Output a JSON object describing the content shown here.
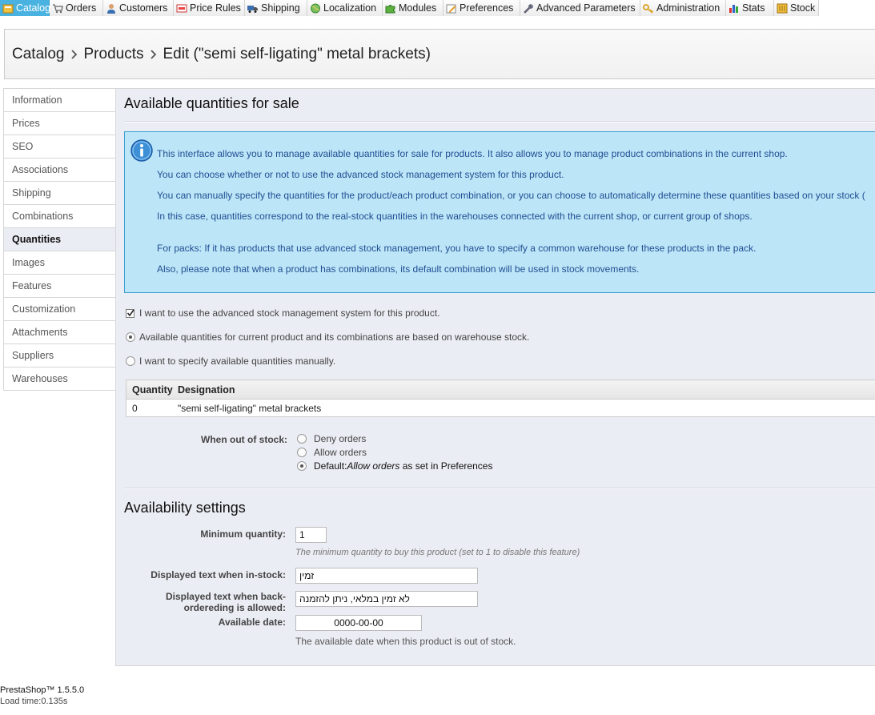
{
  "nav": {
    "tabs": [
      {
        "label": "Catalog",
        "icon": "catalog-icon",
        "active": true
      },
      {
        "label": "Orders",
        "icon": "cart-icon"
      },
      {
        "label": "Customers",
        "icon": "customers-icon"
      },
      {
        "label": "Price Rules",
        "icon": "price-rules-icon"
      },
      {
        "label": "Shipping",
        "icon": "truck-icon"
      },
      {
        "label": "Localization",
        "icon": "globe-icon"
      },
      {
        "label": "Modules",
        "icon": "puzzle-icon"
      },
      {
        "label": "Preferences",
        "icon": "preferences-icon"
      },
      {
        "label": "Advanced Parameters",
        "icon": "wrench-icon"
      },
      {
        "label": "Administration",
        "icon": "key-icon"
      },
      {
        "label": "Stats",
        "icon": "stats-icon"
      },
      {
        "label": "Stock",
        "icon": "stock-icon"
      }
    ]
  },
  "breadcrumb": {
    "level1": "Catalog",
    "level2": "Products",
    "level3": "Edit (\"semi self-ligating\" metal brackets)"
  },
  "sidebar": {
    "items": [
      {
        "label": "Information"
      },
      {
        "label": "Prices"
      },
      {
        "label": "SEO"
      },
      {
        "label": "Associations"
      },
      {
        "label": "Shipping"
      },
      {
        "label": "Combinations"
      },
      {
        "label": "Quantities",
        "active": true
      },
      {
        "label": "Images"
      },
      {
        "label": "Features"
      },
      {
        "label": "Customization"
      },
      {
        "label": "Attachments"
      },
      {
        "label": "Suppliers"
      },
      {
        "label": "Warehouses"
      }
    ]
  },
  "quantities": {
    "title": "Available quantities for sale",
    "info": {
      "line1": "This interface allows you to manage available quantities for sale for products. It also allows you to manage product combinations in the current shop.",
      "line2": "You can choose whether or not to use the advanced stock management system for this product.",
      "line3": "You can manually specify the quantities for the product/each product combination, or you can choose to automatically determine these quantities based on your stock (",
      "line4": "In this case, quantities correspond to the real-stock quantities in the warehouses connected with the current shop, or current group of shops.",
      "line5": "For packs: If it has products that use advanced stock management, you have to specify a common warehouse for these products in the pack.",
      "line6": "Also, please note that when a product has combinations, its default combination will be used in stock movements."
    },
    "advanced_stock_label": "I want to use the advanced stock management system for this product.",
    "advanced_stock_checked": true,
    "mode_warehouse_label": "Available quantities for current product and its combinations are based on warehouse stock.",
    "mode_manual_label": "I want to specify available quantities manually.",
    "mode_selected": "warehouse",
    "table": {
      "headers": [
        "Quantity",
        "Designation"
      ],
      "rows": [
        {
          "quantity": "0",
          "designation": "\"semi self-ligating\" metal brackets"
        }
      ]
    },
    "out_of_stock": {
      "label": "When out of stock:",
      "deny": "Deny orders",
      "allow": "Allow orders",
      "default_prefix": "Default: ",
      "default_em": "Allow orders",
      "default_suffix": " as set in Preferences",
      "selected": "default"
    }
  },
  "availability": {
    "title": "Availability settings",
    "min_qty_label": "Minimum quantity:",
    "min_qty_value": "1",
    "min_qty_hint": "The minimum quantity to buy this product (set to 1 to disable this feature)",
    "in_stock_label": "Displayed text when in-stock:",
    "in_stock_value": "זמין",
    "backorder_label_line1": "Displayed text when back-",
    "backorder_label_line2": "ordereding is allowed:",
    "backorder_value": "לא זמין במלאי, ניתן להזמנה",
    "date_label": "Available date:",
    "date_value": "0000-00-00",
    "date_hint": "The available date when this product is out of stock."
  },
  "footer": {
    "version": "PrestaShop™ 1.5.5.0",
    "load_time": "Load time:0.135s"
  }
}
